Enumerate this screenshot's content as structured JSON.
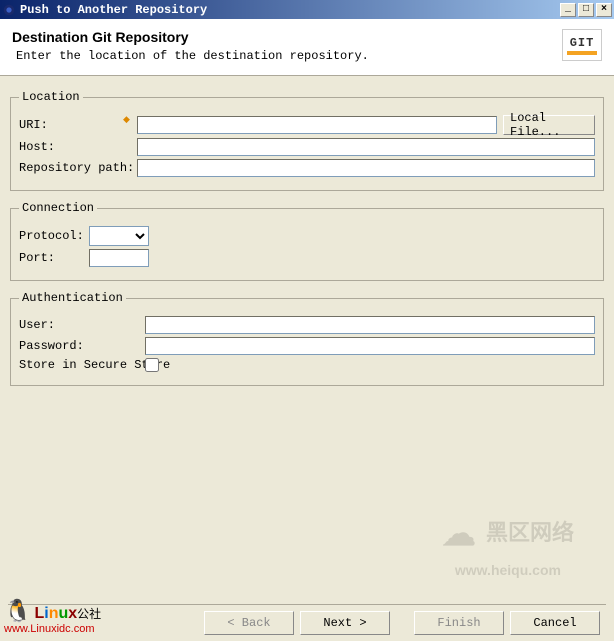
{
  "window": {
    "title": "Push to Another Repository",
    "min": "_",
    "max": "□",
    "close": "×"
  },
  "header": {
    "title": "Destination Git Repository",
    "subtitle": "Enter the location of the destination repository.",
    "git_text": "GIT"
  },
  "location": {
    "legend": "Location",
    "uri_label": "URI:",
    "uri_value": "",
    "local_file_label": "Local File...",
    "host_label": "Host:",
    "host_value": "",
    "repo_path_label": "Repository path:",
    "repo_path_value": ""
  },
  "connection": {
    "legend": "Connection",
    "protocol_label": "Protocol:",
    "protocol_value": "",
    "port_label": "Port:",
    "port_value": ""
  },
  "authentication": {
    "legend": "Authentication",
    "user_label": "User:",
    "user_value": "",
    "password_label": "Password:",
    "password_value": "",
    "store_label": "Store in Secure Store"
  },
  "footer": {
    "back": "< Back",
    "next": "Next >",
    "finish": "Finish",
    "cancel": "Cancel"
  },
  "watermarks": {
    "brand_cn": "公社",
    "url1": "www.Linuxidc.com",
    "text2a": "黑区网络",
    "text2b": "www.heiqu.com"
  }
}
